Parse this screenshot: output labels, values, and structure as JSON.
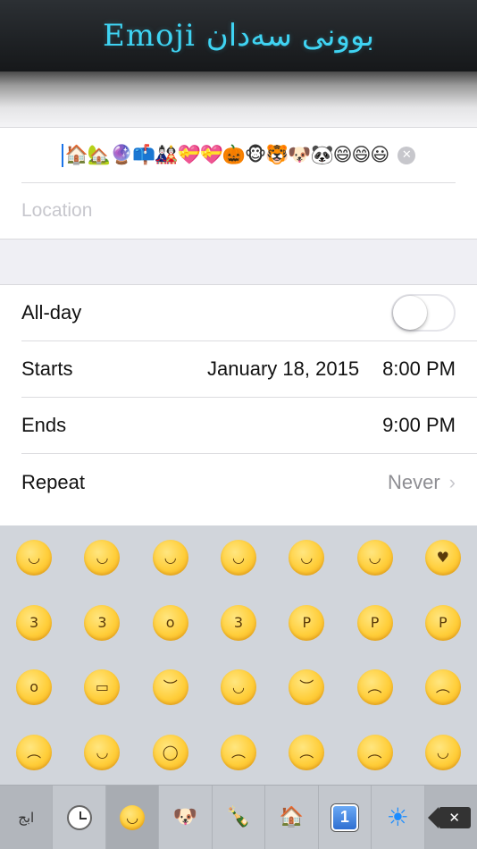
{
  "banner": {
    "title": "Emoji بوونی سەدان"
  },
  "event": {
    "title_value": "🏠🏡🔮📫🎎💝💝🎃🐵🐯🐶🐼😄😄😃",
    "location_placeholder": "Location"
  },
  "details": {
    "allday": {
      "label": "All-day",
      "on": false
    },
    "starts": {
      "label": "Starts",
      "date": "January 18, 2015",
      "time": "8:00 PM"
    },
    "ends": {
      "label": "Ends",
      "time": "9:00 PM"
    },
    "repeat": {
      "label": "Repeat",
      "value": "Never"
    }
  },
  "keyboard": {
    "emojis": [
      {
        "name": "smile",
        "mouth": "◡"
      },
      {
        "name": "smiley",
        "mouth": "◡"
      },
      {
        "name": "grinning",
        "mouth": "◡"
      },
      {
        "name": "blush",
        "mouth": "◡"
      },
      {
        "name": "relaxed",
        "mouth": "◡"
      },
      {
        "name": "wink",
        "mouth": "◡"
      },
      {
        "name": "heart-eyes",
        "mouth": "♥"
      },
      {
        "name": "kissing-heart",
        "mouth": "3"
      },
      {
        "name": "kissing-closed-eyes",
        "mouth": "3"
      },
      {
        "name": "kissing",
        "mouth": "o"
      },
      {
        "name": "kissing-smiling-eyes",
        "mouth": "3"
      },
      {
        "name": "stuck-out-tongue-winking-eye",
        "mouth": "P"
      },
      {
        "name": "stuck-out-tongue-closed-eyes",
        "mouth": "P"
      },
      {
        "name": "stuck-out-tongue",
        "mouth": "P"
      },
      {
        "name": "flushed",
        "mouth": "o"
      },
      {
        "name": "grimacing",
        "mouth": "▭"
      },
      {
        "name": "pensive",
        "mouth": "︶"
      },
      {
        "name": "relieved",
        "mouth": "◡"
      },
      {
        "name": "unamused",
        "mouth": "︶"
      },
      {
        "name": "disappointed",
        "mouth": "︵"
      },
      {
        "name": "persevere",
        "mouth": "︵"
      },
      {
        "name": "cry",
        "mouth": "︵"
      },
      {
        "name": "joy",
        "mouth": "◡"
      },
      {
        "name": "sob",
        "mouth": "◯"
      },
      {
        "name": "sleepy",
        "mouth": "︵"
      },
      {
        "name": "disappointed-relieved",
        "mouth": "︵"
      },
      {
        "name": "cold-sweat",
        "mouth": "︵"
      },
      {
        "name": "sweat-smile",
        "mouth": "◡"
      }
    ],
    "switch_label": "ابج",
    "categories": [
      "recent",
      "people",
      "nature",
      "places-objects",
      "buildings",
      "symbols",
      "weather"
    ],
    "delete_glyph": "✕"
  },
  "colors": {
    "banner_text": "#3fd3f2",
    "cursor": "#1a73e8",
    "secondary_text": "#8e8e93",
    "keyboard_bg": "#d1d5db"
  }
}
